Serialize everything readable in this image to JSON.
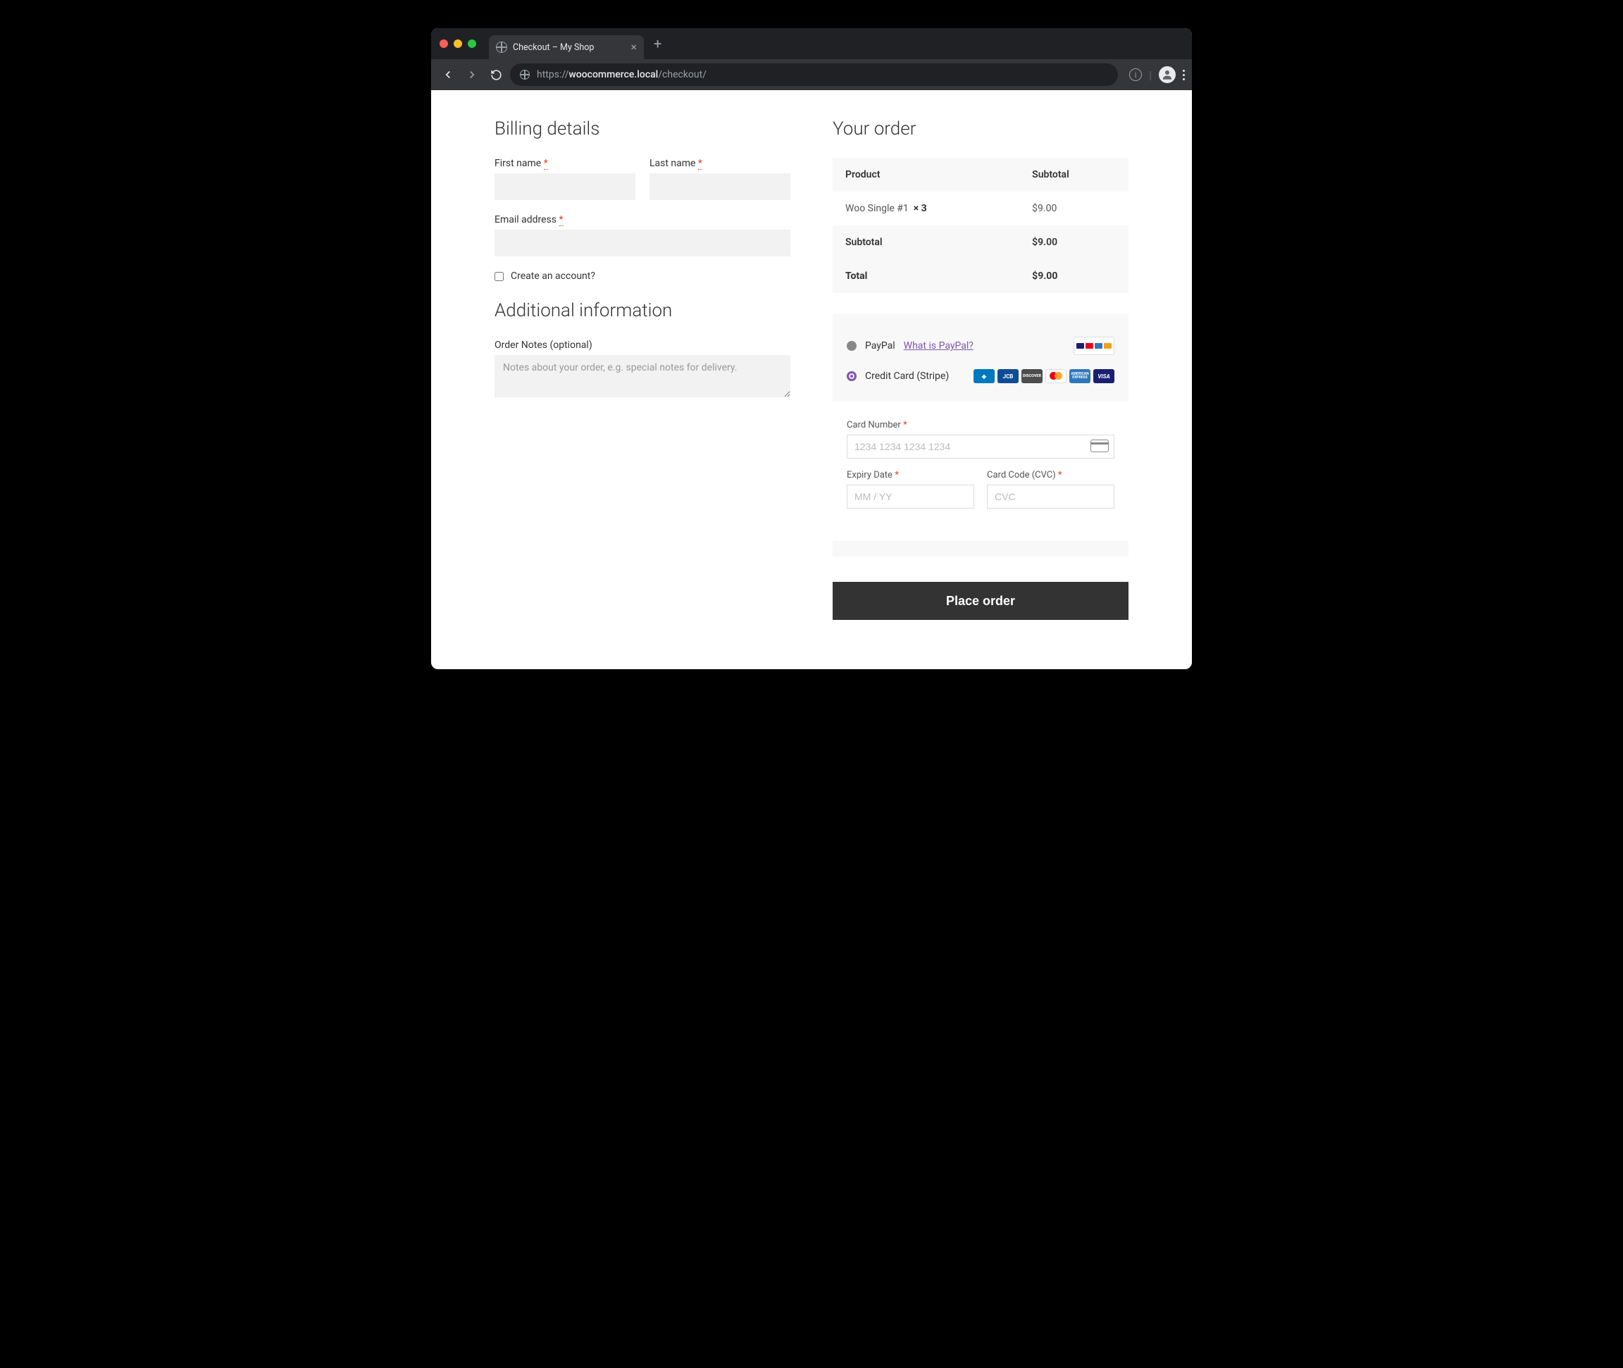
{
  "browser": {
    "tab_title": "Checkout – My Shop",
    "url_scheme": "https://",
    "url_host": "woocommerce.local",
    "url_path": "/checkout/"
  },
  "billing": {
    "heading": "Billing details",
    "first_name_label": "First name",
    "last_name_label": "Last name",
    "email_label": "Email address",
    "create_account_label": "Create an account?"
  },
  "additional": {
    "heading": "Additional information",
    "notes_label": "Order Notes (optional)",
    "notes_placeholder": "Notes about your order, e.g. special notes for delivery."
  },
  "order": {
    "heading": "Your order",
    "th_product": "Product",
    "th_subtotal": "Subtotal",
    "item_name": "Woo Single #1",
    "item_qty": "× 3",
    "item_total": "$9.00",
    "subtotal_label": "Subtotal",
    "subtotal_value": "$9.00",
    "total_label": "Total",
    "total_value": "$9.00"
  },
  "payment": {
    "paypal_label": "PayPal",
    "paypal_link": "What is PayPal?",
    "stripe_label": "Credit Card (Stripe)",
    "card_number_label": "Card Number",
    "card_number_placeholder": "1234 1234 1234 1234",
    "expiry_label": "Expiry Date",
    "expiry_placeholder": "MM / YY",
    "cvc_label": "Card Code (CVC)",
    "cvc_placeholder": "CVC"
  },
  "actions": {
    "place_order": "Place order"
  },
  "required_marker": "*"
}
